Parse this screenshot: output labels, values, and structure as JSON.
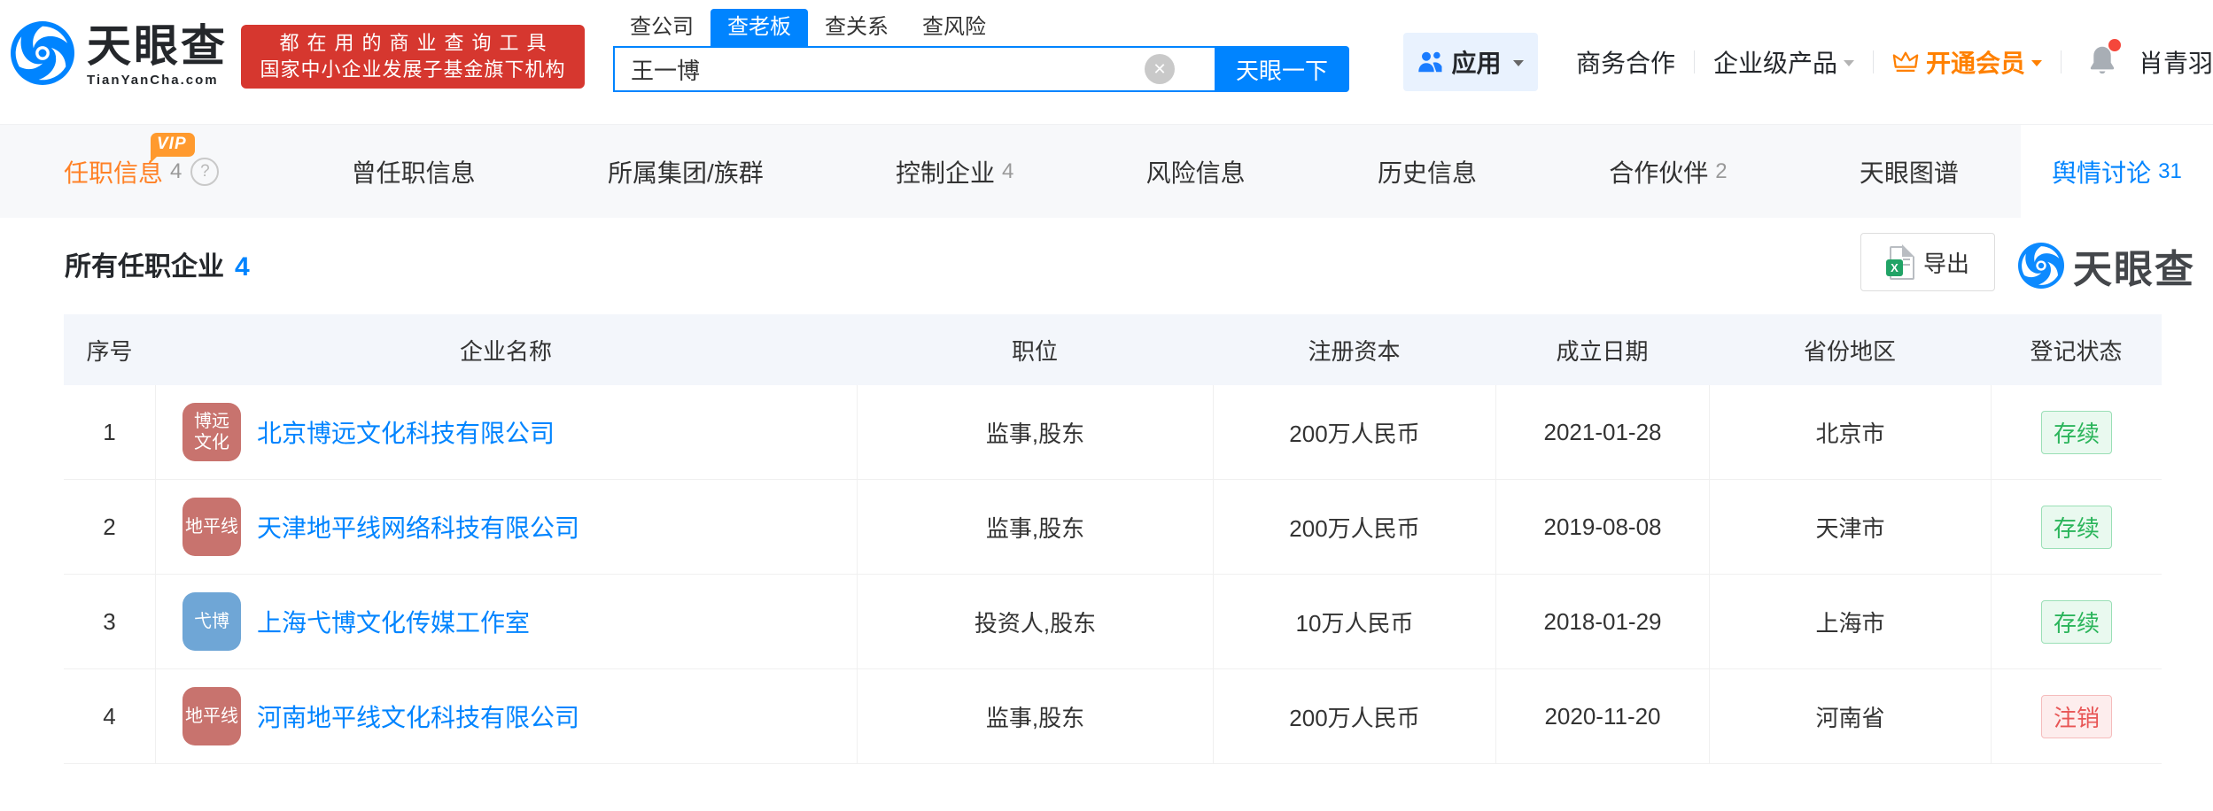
{
  "header": {
    "logo": {
      "brand": "天眼查",
      "domain": "TianYanCha.com"
    },
    "promo": {
      "line1": "都在用的商业查询工具",
      "line2": "国家中小企业发展子基金旗下机构"
    },
    "search": {
      "tabs": [
        {
          "label": "查公司"
        },
        {
          "label": "查老板",
          "active": true
        },
        {
          "label": "查关系"
        },
        {
          "label": "查风险"
        }
      ],
      "value": "王一博",
      "button": "天眼一下"
    },
    "nav_right": {
      "apps": "应用",
      "business": "商务合作",
      "enterprise": "企业级产品",
      "vip": "开通会员",
      "username": "肖青羽"
    }
  },
  "tabs_bar": {
    "vip_badge": "VIP",
    "help_glyph": "?",
    "items": [
      {
        "label": "任职信息",
        "count": "4"
      },
      {
        "label": "曾任职信息"
      },
      {
        "label": "所属集团/族群"
      },
      {
        "label": "控制企业",
        "count": "4"
      },
      {
        "label": "风险信息"
      },
      {
        "label": "历史信息"
      },
      {
        "label": "合作伙伴",
        "count": "2"
      },
      {
        "label": "天眼图谱"
      },
      {
        "label": "舆情讨论",
        "count": "31"
      }
    ]
  },
  "content": {
    "title": "所有任职企业",
    "title_count": "4",
    "export_label": "导出",
    "excel_glyph": "X",
    "watermark": "天眼查"
  },
  "table": {
    "columns": [
      "序号",
      "企业名称",
      "职位",
      "注册资本",
      "成立日期",
      "省份地区",
      "登记状态"
    ],
    "rows": [
      {
        "no": "1",
        "avatar": {
          "lines": [
            "博远",
            "文化"
          ],
          "color": "#c8736e"
        },
        "company": "北京博远文化科技有限公司",
        "position": "监事,股东",
        "capital": "200万人民币",
        "date": "2021-01-28",
        "region": "北京市",
        "status": {
          "label": "存续",
          "type": "active"
        }
      },
      {
        "no": "2",
        "avatar": {
          "lines": [
            "地平线"
          ],
          "color": "#c8736e"
        },
        "company": "天津地平线网络科技有限公司",
        "position": "监事,股东",
        "capital": "200万人民币",
        "date": "2019-08-08",
        "region": "天津市",
        "status": {
          "label": "存续",
          "type": "active"
        }
      },
      {
        "no": "3",
        "avatar": {
          "lines": [
            "弋博"
          ],
          "color": "#6fa6d6"
        },
        "company": "上海弋博文化传媒工作室",
        "position": "投资人,股东",
        "capital": "10万人民币",
        "date": "2018-01-29",
        "region": "上海市",
        "status": {
          "label": "存续",
          "type": "active"
        }
      },
      {
        "no": "4",
        "avatar": {
          "lines": [
            "地平线"
          ],
          "color": "#c8736e"
        },
        "company": "河南地平线文化科技有限公司",
        "position": "监事,股东",
        "capital": "200万人民币",
        "date": "2020-11-20",
        "region": "河南省",
        "status": {
          "label": "注销",
          "type": "revoked"
        }
      }
    ]
  },
  "colors": {
    "brand_blue": "#0084ff",
    "banner_red": "#d6372f",
    "active_tab_orange": "#ff8126",
    "vip_orange": "#ff9a2e",
    "link_blue": "#0084ff",
    "status_active_green": "#2bb55b",
    "status_revoked_red": "#e85656"
  }
}
